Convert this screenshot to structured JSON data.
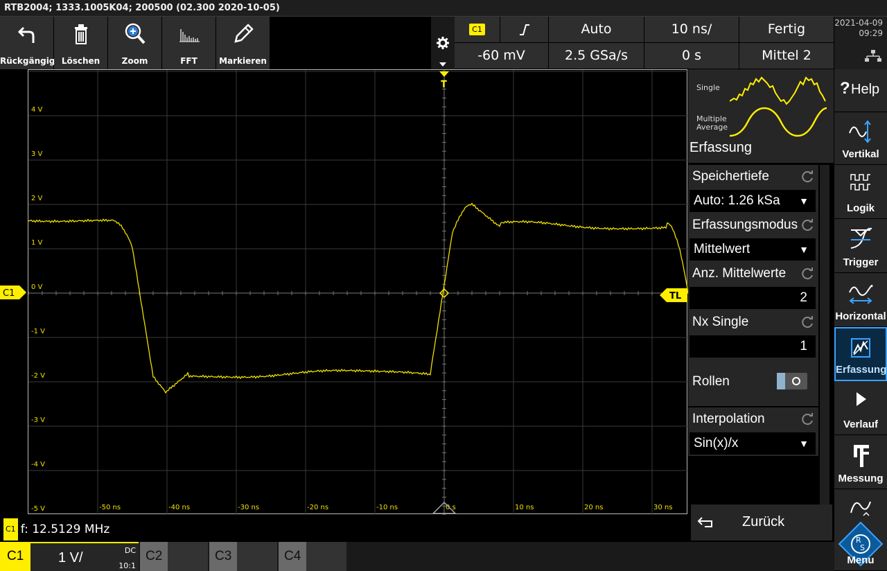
{
  "title": "RTB2004; 1333.1005K04; 200500 (02.300 2020-10-05)",
  "toolbar": [
    {
      "label": "Rückgängig",
      "icon": "undo-icon"
    },
    {
      "label": "Löschen",
      "icon": "trash-icon"
    },
    {
      "label": "Zoom",
      "icon": "zoom-icon"
    },
    {
      "label": "FFT",
      "icon": "fft-icon"
    },
    {
      "label": "Markieren",
      "icon": "pencil-icon"
    }
  ],
  "trigger": {
    "source": "C1",
    "level": "-60 mV",
    "mode": "Auto",
    "samplerate": "2.5 GSa/s",
    "timebase": "10 ns/",
    "position": "0 s",
    "status": "Fertig",
    "acq": "Mittel 2"
  },
  "datetime": {
    "date": "2021-04-09",
    "time": "09:29"
  },
  "plot": {
    "color": "#f0e000",
    "y_labels": [
      "4 V",
      "3 V",
      "2 V",
      "1 V",
      "0 V",
      "-1 V",
      "-2 V",
      "-3 V",
      "-4 V",
      "-5 V"
    ],
    "x_labels": [
      "-50 ns",
      "-40 ns",
      "-30 ns",
      "-20 ns",
      "-10 ns",
      "0 s",
      "10 ns",
      "20 ns",
      "30 ns"
    ],
    "c1_label": "C1",
    "tl_label": "TL",
    "trigger_label": "T"
  },
  "acq_panel": {
    "single_label": "Single",
    "multi_label_1": "Multiple",
    "multi_label_2": "Average",
    "title": "Erfassung"
  },
  "settings": [
    {
      "header": "Speichertiefe",
      "value": "Auto: 1.26 kSa",
      "type": "select"
    },
    {
      "header": "Erfassungsmodus",
      "value": "Mittelwert",
      "type": "select"
    },
    {
      "header": "Anz. Mittelwerte",
      "value": "2",
      "type": "number"
    },
    {
      "header": "Nx Single",
      "value": "1",
      "type": "number"
    }
  ],
  "rollen": {
    "label": "Rollen",
    "state": "off"
  },
  "interpolation": {
    "header": "Interpolation",
    "value": "Sin(x)/x"
  },
  "back": {
    "label": "Zurück"
  },
  "side_menu": [
    {
      "label": "Help",
      "prefix": "?",
      "icon": "help-icon"
    },
    {
      "label": "Vertikal",
      "icon": "vertical-icon"
    },
    {
      "label": "Logik",
      "icon": "logic-icon"
    },
    {
      "label": "Trigger",
      "icon": "trigger-icon"
    },
    {
      "label": "Horizontal",
      "icon": "horizontal-icon"
    },
    {
      "label": "Erfassung",
      "icon": "acquisition-icon",
      "active": true
    },
    {
      "label": "Verlauf",
      "icon": "play-icon"
    },
    {
      "label": "Messung",
      "icon": "caliper-icon"
    },
    {
      "label": "Menu",
      "icon": "rs-logo-icon"
    }
  ],
  "measurement": {
    "tag": "C1",
    "text": "f: 12.5129 MHz"
  },
  "channels": [
    {
      "name": "C1",
      "scale": "1 V/",
      "coupling": "DC",
      "probe": "10:1",
      "active": true
    },
    {
      "name": "C2"
    },
    {
      "name": "C3"
    },
    {
      "name": "C4"
    }
  ]
}
